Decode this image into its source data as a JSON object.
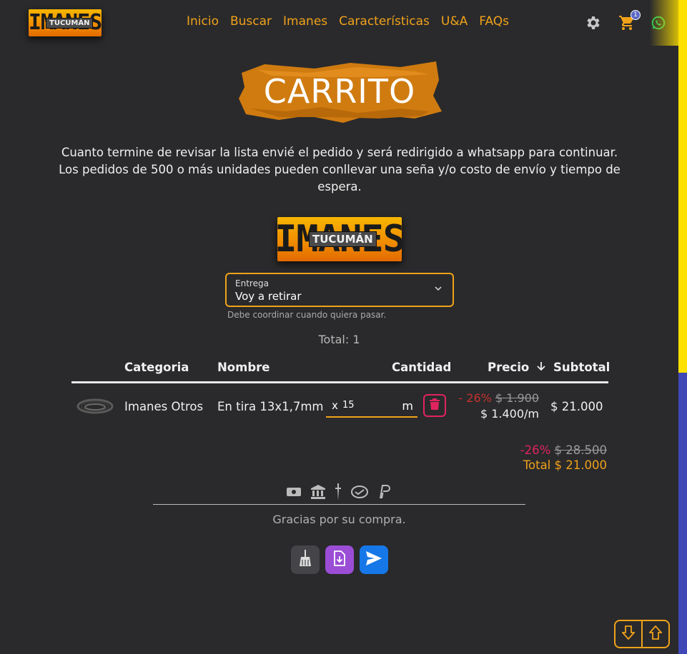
{
  "header": {
    "logo_top": "IMANES",
    "logo_sub": "TUCUMÁN",
    "nav": [
      "Inicio",
      "Buscar",
      "Imanes",
      "Características",
      "U&A",
      "FAQs"
    ],
    "cart_count": "1",
    "icons": [
      "gear-icon",
      "cart-icon",
      "whatsapp-icon"
    ]
  },
  "page": {
    "title": "CARRITO",
    "intro_line1": "Cuanto termine de revisar la lista envié el pedido y será redirigido a whatsapp para continuar.",
    "intro_line2": "Los pedidos de 500 o más unidades pueden conllevar una seña y/o costo de envío y tiempo de espera."
  },
  "delivery": {
    "label": "Entrega",
    "value": "Voy a retirar",
    "helper": "Debe coordinar cuando quiera pasar."
  },
  "summary": {
    "total_count": "Total: 1"
  },
  "table": {
    "headers": {
      "categoria": "Categoria",
      "nombre": "Nombre",
      "cantidad": "Cantidad",
      "precio": "Precio",
      "subtotal": "Subtotal"
    },
    "rows": [
      {
        "categoria": "Imanes Otros",
        "nombre": "En tira 13x1,7mm",
        "qty_prefix": "x",
        "qty": "15",
        "unit": "m",
        "discount": "- 26%",
        "old_price": "$ 1.900",
        "price": "$ 1.400/m",
        "subtotal": "$ 21.000"
      }
    ]
  },
  "totals": {
    "discount": "-26%",
    "old_total": "$ 28.500",
    "total": "Total $ 21.000"
  },
  "payment_icons": [
    "cash-icon",
    "bank-icon",
    "transfer-icon",
    "handshake-icon",
    "paypal-icon"
  ],
  "footer": {
    "thanks": "Gracias por su compra."
  },
  "colors": {
    "accent": "#f0a21a",
    "danger": "#e0245e",
    "background": "#2a2a2c",
    "send": "#1677e8",
    "pdf": "#9b4dd6"
  }
}
